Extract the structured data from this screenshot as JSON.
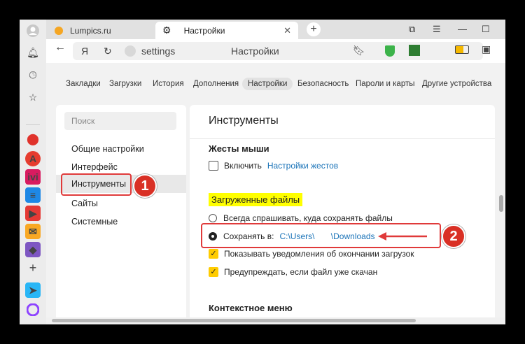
{
  "browser": {
    "tabs": [
      {
        "label": "Lumpics.ru"
      },
      {
        "label": "Настройки"
      }
    ],
    "address": {
      "prefix": "Я",
      "url": "settings",
      "title": "Настройки"
    }
  },
  "settings_nav": [
    {
      "label": "Закладки"
    },
    {
      "label": "Загрузки"
    },
    {
      "label": "История"
    },
    {
      "label": "Дополнения"
    },
    {
      "label": "Настройки",
      "selected": true
    },
    {
      "label": "Безопасность"
    },
    {
      "label": "Пароли и карты"
    },
    {
      "label": "Другие устройства"
    }
  ],
  "sidebar": {
    "search_placeholder": "Поиск",
    "items": [
      {
        "label": "Общие настройки"
      },
      {
        "label": "Интерфейс"
      },
      {
        "label": "Инструменты",
        "active": true
      },
      {
        "label": "Сайты"
      },
      {
        "label": "Системные"
      }
    ]
  },
  "main": {
    "title": "Инструменты",
    "mouse_gestures": {
      "heading": "Жесты мыши",
      "enable_label": "Включить",
      "enable_checked": false,
      "settings_link": "Настройки жестов"
    },
    "downloads": {
      "heading": "Загруженные файлы",
      "ask_label": "Всегда спрашивать, куда сохранять файлы",
      "save_label": "Сохранять в:",
      "save_path": "C:\\Users\\       \\Downloads",
      "notify_label": "Показывать уведомления об окончании загрузок",
      "warn_label": "Предупреждать, если файл уже скачан"
    },
    "context_menu_heading": "Контекстное меню"
  },
  "annotations": {
    "badge1": "1",
    "badge2": "2"
  },
  "colors": {
    "accent_red": "#e03a3a",
    "highlight_yellow": "#ffff00",
    "checkbox_yellow": "#ffcc00",
    "link_blue": "#1a73b8"
  }
}
